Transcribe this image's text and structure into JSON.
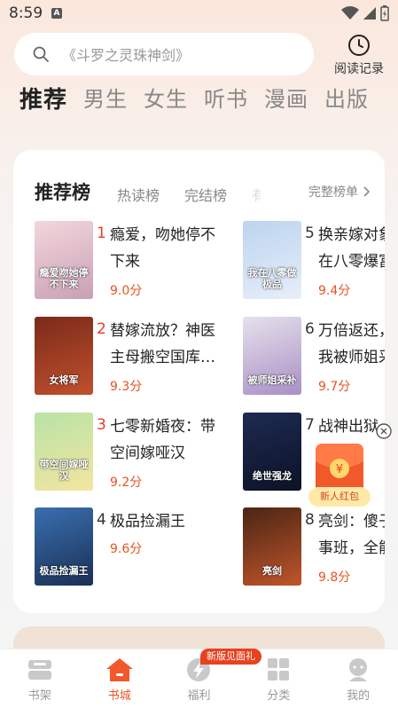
{
  "status_bar": {
    "time": "8:59",
    "app_badge": "A"
  },
  "search": {
    "placeholder": "《斗罗之灵珠神剑》"
  },
  "history": {
    "label": "阅读记录"
  },
  "top_tabs": [
    "推荐",
    "男生",
    "女生",
    "听书",
    "漫画",
    "出版"
  ],
  "rank_tabs": [
    "推荐榜",
    "热读榜",
    "完结榜",
    "有"
  ],
  "rank_all_label": "完整榜单",
  "books": [
    {
      "rank": "1",
      "title": "瘾爱，吻她停不下来",
      "score": "9.0分",
      "cover_colors": [
        "#f3d6dc",
        "#c9a0b4"
      ],
      "cover_text": "瘾爱吻她停不下来"
    },
    {
      "rank": "2",
      "title": "替嫁流放？神医主母搬空国库…",
      "score": "9.3分",
      "cover_colors": [
        "#7a2a1a",
        "#c1502d"
      ],
      "cover_text": "女将军"
    },
    {
      "rank": "3",
      "title": "七零新婚夜：带空间嫁哑汉",
      "score": "9.2分",
      "cover_colors": [
        "#b7e3a6",
        "#f4e5a0"
      ],
      "cover_text": "带空间嫁哑汉"
    },
    {
      "rank": "4",
      "title": "极品捡漏王",
      "score": "9.6分",
      "cover_colors": [
        "#3a6fb0",
        "#1a2f55"
      ],
      "cover_text": "极品捡漏王"
    },
    {
      "rank": "5",
      "title": "换亲嫁对象在八零爆富",
      "score": "9.4分",
      "cover_colors": [
        "#bcd4ef",
        "#e8eef8"
      ],
      "cover_text": "我在八零做极品"
    },
    {
      "rank": "6",
      "title": "万倍返还，我被师姐采补",
      "score": "9.7分",
      "cover_colors": [
        "#e6e1ec",
        "#a98fc6"
      ],
      "cover_text": "被师姐采补"
    },
    {
      "rank": "7",
      "title": "战神出狱",
      "score": "",
      "cover_colors": [
        "#1d2a52",
        "#0c1226"
      ],
      "cover_text": "绝世强龙"
    },
    {
      "rank": "8",
      "title": "亮剑：傻子事班，全能",
      "score": "9.8分",
      "cover_colors": [
        "#4a2515",
        "#c0552a"
      ],
      "cover_text": "亮剑"
    }
  ],
  "redpack": {
    "label": "新人红包"
  },
  "bottom_nav": {
    "items": [
      {
        "label": "书架",
        "icon": "bookshelf-icon"
      },
      {
        "label": "书城",
        "icon": "bookstore-icon"
      },
      {
        "label": "福利",
        "icon": "lightning-icon"
      },
      {
        "label": "分类",
        "icon": "category-icon"
      },
      {
        "label": "我的",
        "icon": "profile-icon"
      }
    ],
    "badge": "新版见面礼",
    "active_index": 1
  },
  "colors": {
    "accent": "#e8541f",
    "rank_red": "#e23c2a",
    "highlight": "#f0502d"
  }
}
